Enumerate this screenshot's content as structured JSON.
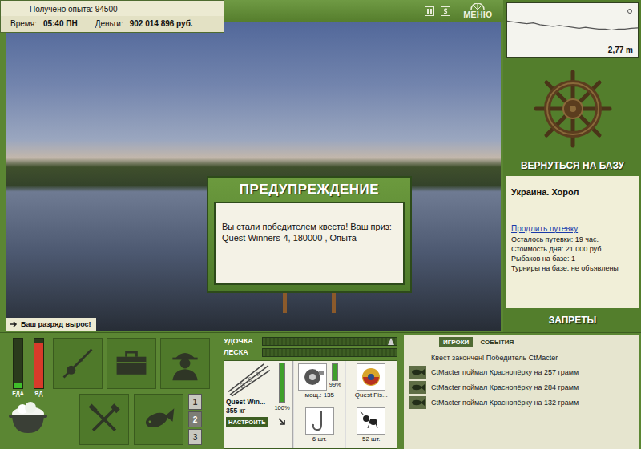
{
  "header": {
    "experience": "Получено опыта: 94500",
    "time_label": "Время:",
    "time": "05:40 ПН",
    "money_label": "Деньги:",
    "money": "902 014 896 руб.",
    "menu": "МЕНЮ"
  },
  "scene": {
    "notice": "Ваш разряд вырос!"
  },
  "dialog": {
    "title": "ПРЕДУПРЕЖДЕНИЕ",
    "message": "Вы стали победителем квеста! Ваш приз: Quest Winners-4, 180000 , Опыта"
  },
  "depth": {
    "reading": "2,77 m",
    "profile": [
      2.0,
      2.1,
      2.2,
      2.3,
      2.2,
      2.4,
      2.5,
      2.6,
      2.5,
      2.6,
      2.7,
      2.8,
      2.7,
      2.8,
      2.9,
      2.9,
      3.0,
      2.9,
      2.9,
      2.8,
      2.77
    ]
  },
  "base": {
    "button": "ВЕРНУТЬСЯ НА БАЗУ",
    "name": "Украина. Хорол",
    "extend_link": "Продлить путевку",
    "facts": [
      "Осталось путевки: 19 час.",
      "Стоимость дня: 21 000 руб.",
      "Рыбаков на базе: 1",
      "Турниры на базе: не объявлены"
    ],
    "bans": "ЗАПРЕТЫ"
  },
  "meters": [
    {
      "label": "ЕДА",
      "level": 0.1,
      "color": "#3fbf2a"
    },
    {
      "label": "ЯД",
      "level": 0.9,
      "color": "#d83a2a"
    }
  ],
  "slots": [
    {
      "label": "1",
      "selected": false
    },
    {
      "label": "2",
      "selected": true
    },
    {
      "label": "3",
      "selected": false
    }
  ],
  "tension_bars": [
    {
      "label": "УДОЧКА",
      "level": 0,
      "marker_level": 0.96
    },
    {
      "label": "ЛЕСКА",
      "level": 0,
      "marker_level": null
    }
  ],
  "tackle": {
    "rod": {
      "name": "Quest Win...",
      "weight": "355 кг",
      "condition": "100%",
      "level": 1.0
    },
    "setup_button": "НАСТРОИТЬ",
    "reel": {
      "power": "мощ.: 135",
      "condition": "99%",
      "level": 0.99
    },
    "lure": {
      "name": "Quest Fis..."
    },
    "hook": {
      "count": "6 шт."
    },
    "bait": {
      "count": "52 шт."
    }
  },
  "chat": {
    "tabs": [
      {
        "label": "ИГРОКИ",
        "selected": true
      },
      {
        "label": "СОБЫТИЯ",
        "selected": false
      }
    ],
    "messages": [
      {
        "kind": "system",
        "text": "Квест закончен! Победитель CtMacter"
      },
      {
        "kind": "catch",
        "text": "CtMacter поймал Краснопёрку на 257 грамм"
      },
      {
        "kind": "catch",
        "text": "CtMacter поймал Краснопёрку на 284 грамм"
      },
      {
        "kind": "catch",
        "text": "CtMacter поймал Краснопёрку на 132 грамм"
      }
    ]
  }
}
